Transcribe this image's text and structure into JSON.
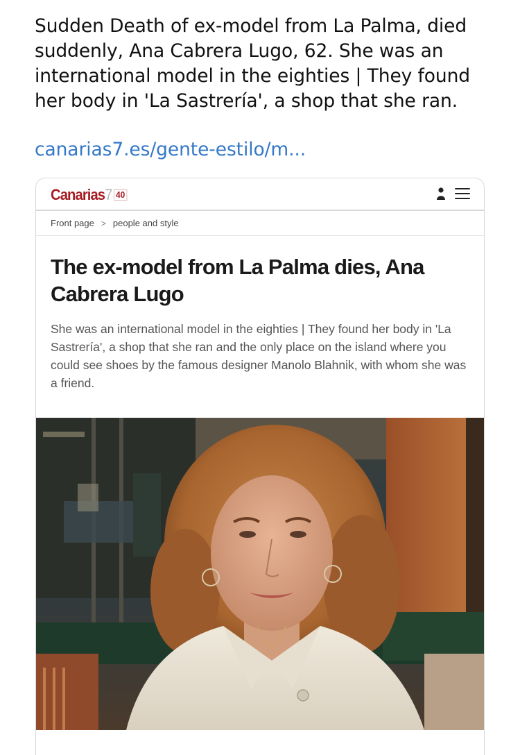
{
  "post": {
    "text": "Sudden Death of ex-model from La Palma, died suddenly, Ana Cabrera Lugo, 62. She was an international model in the eighties | They found her body in 'La Sastrería', a shop that she ran.",
    "link": "canarias7.es/gente-estilo/m..."
  },
  "site": {
    "logo_name": "Canarias",
    "logo_seven": "7",
    "logo_badge": "40",
    "brand_color": "#a51d24",
    "header_icons": [
      "user-icon",
      "menu-icon"
    ]
  },
  "breadcrumb": {
    "items": [
      "Front page",
      "people and style"
    ],
    "separator": ">"
  },
  "article": {
    "headline": "The ex-model from La Palma dies, Ana Cabrera Lugo",
    "subhead": "She was an international model in the eighties | They found her body in 'La Sastrería', a shop that she ran and the only place on the island where you could see shoes by the famous designer Manolo Blahnik, with whom she was a friend."
  }
}
